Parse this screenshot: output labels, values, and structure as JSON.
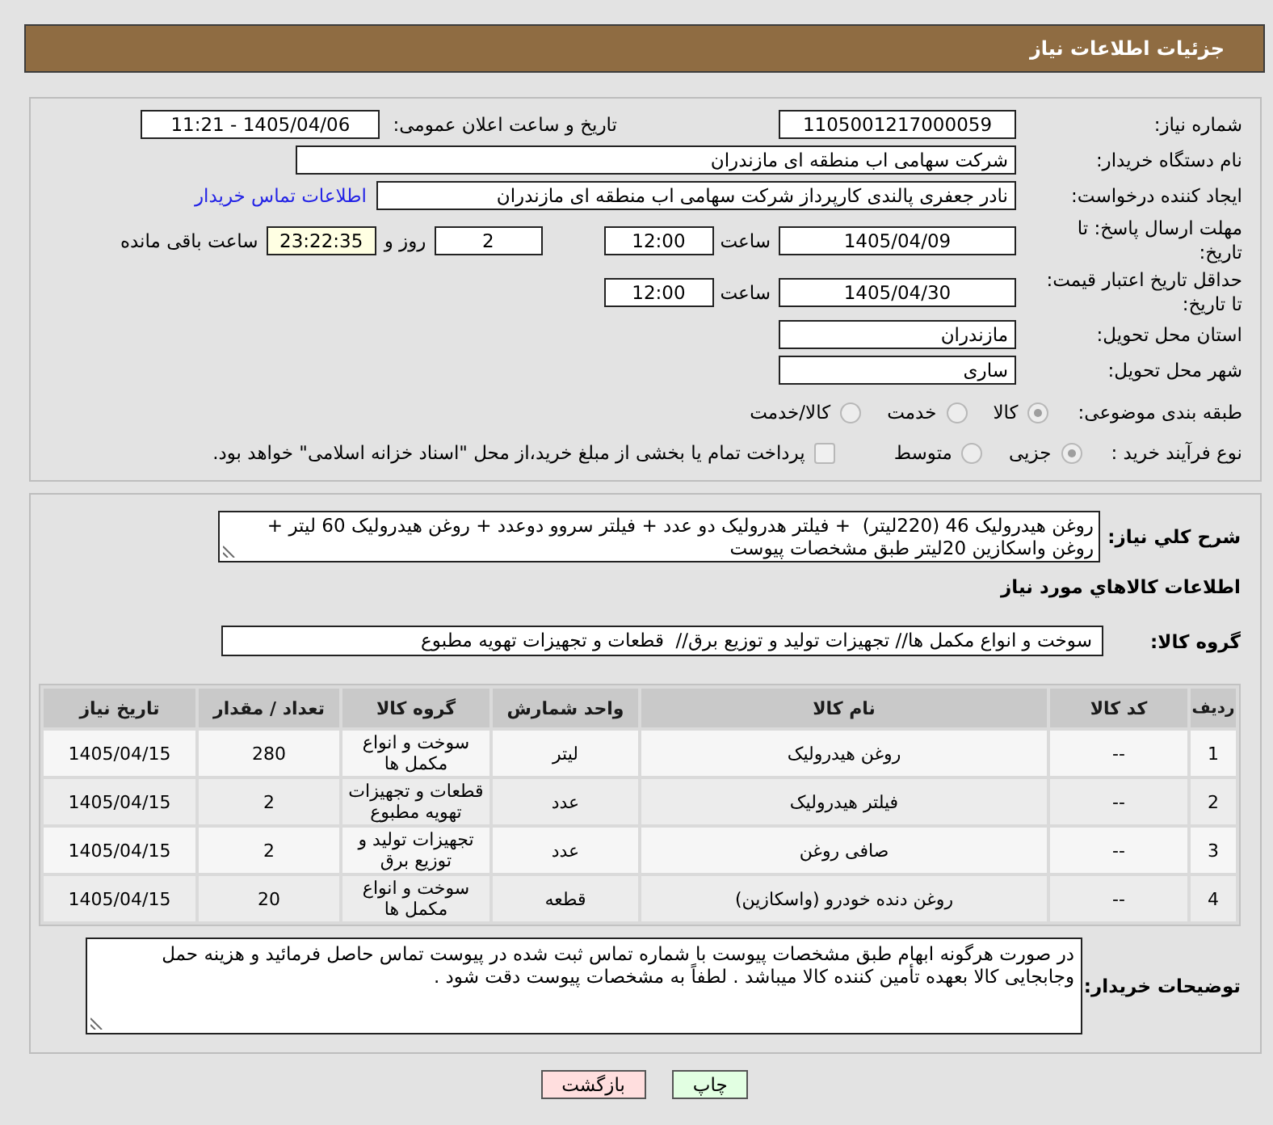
{
  "header": {
    "title": "جزئیات اطلاعات نیاز"
  },
  "details": {
    "need_number": {
      "label": "شماره نیاز:",
      "value": "1105001217000059"
    },
    "announce_datetime": {
      "label": "تاریخ و ساعت اعلان عمومی:",
      "value": "1405/04/06 - 11:21"
    },
    "buyer_org": {
      "label": "نام دستگاه خریدار:",
      "value": "شرکت سهامی اب منطقه ای مازندران"
    },
    "requester": {
      "label": "ایجاد کننده درخواست:",
      "value": "نادر جعفری پالندی کارپرداز شرکت سهامی اب منطقه ای مازندران",
      "contact_link": "اطلاعات تماس خریدار"
    },
    "reply_deadline": {
      "label": "مهلت ارسال پاسخ: تا تاریخ:",
      "date": "1405/04/09",
      "time_label": "ساعت",
      "time": "12:00",
      "days": "2",
      "days_label": "روز و",
      "remaining": "23:22:35",
      "remaining_label": "ساعت باقی مانده"
    },
    "price_validity": {
      "label": "حداقل تاریخ اعتبار قیمت: تا تاریخ:",
      "date": "1405/04/30",
      "time_label": "ساعت",
      "time": "12:00"
    },
    "delivery_province": {
      "label": "استان محل تحویل:",
      "value": "مازندران"
    },
    "delivery_city": {
      "label": "شهر محل تحویل:",
      "value": "ساری"
    },
    "subject_category": {
      "label": "طبقه بندی موضوعی:",
      "options": [
        {
          "label": "کالا",
          "selected": true,
          "disabled": true
        },
        {
          "label": "خدمت",
          "selected": false,
          "disabled": true
        },
        {
          "label": "کالا/خدمت",
          "selected": false,
          "disabled": true
        }
      ]
    },
    "purchase_process": {
      "label": "نوع فرآیند خرید :",
      "options": [
        {
          "label": "جزیی",
          "selected": true,
          "disabled": true
        },
        {
          "label": "متوسط",
          "selected": false,
          "disabled": true
        }
      ],
      "treasury_payment": {
        "label": "پرداخت تمام یا بخشی از مبلغ خرید،از محل \"اسناد خزانه اسلامی\" خواهد بود.",
        "checked": false,
        "disabled": true
      }
    }
  },
  "needs": {
    "summary": {
      "label": "شرح کلي نياز:",
      "value": "روغن هیدرولیک 46 (220لیتر)  + فیلتر هدرولیک دو عدد + فیلتر سروو دوعدد + روغن هیدرولیک 60 لیتر + روغن واسکازین 20لیتر طبق مشخصات پیوست"
    },
    "items_heading": "اطلاعات كالاهاي مورد نياز",
    "goods_group": {
      "label": "گروه کالا:",
      "value": "سوخت و انواع مکمل ها// تجهیزات تولید و توزیع برق//  قطعات و تجهیزات تهویه مطبوع"
    },
    "table": {
      "columns": [
        "ردیف",
        "کد کالا",
        "نام کالا",
        "واحد شمارش",
        "گروه کالا",
        "تعداد / مقدار",
        "تاریخ نیاز"
      ],
      "rows": [
        [
          "1",
          "--",
          "روغن هیدرولیک",
          "لیتر",
          "سوخت و انواع مکمل ها",
          "280",
          "1405/04/15"
        ],
        [
          "2",
          "--",
          "فیلتر هیدرولیک",
          "عدد",
          "قطعات و تجهیزات تهویه مطبوع",
          "2",
          "1405/04/15"
        ],
        [
          "3",
          "--",
          "صافی روغن",
          "عدد",
          "تجهیزات تولید و توزیع برق",
          "2",
          "1405/04/15"
        ],
        [
          "4",
          "--",
          "روغن دنده خودرو (واسکازین)",
          "قطعه",
          "سوخت و انواع مکمل ها",
          "20",
          "1405/04/15"
        ]
      ]
    },
    "buyer_notes": {
      "label": "توضیحات خریدار:",
      "value": "در صورت هرگونه ابهام طبق مشخصات پیوست با شماره تماس ثبت شده در پیوست تماس حاصل فرمائید و هزینه حمل وجابجایی کالا بعهده تأمین کننده کالا میباشد . لطفاً به مشخصات پیوست دقت شود ."
    }
  },
  "buttons": [
    {
      "label": "چاپ",
      "kind": "print"
    },
    {
      "label": "بازگشت",
      "kind": "back"
    }
  ]
}
